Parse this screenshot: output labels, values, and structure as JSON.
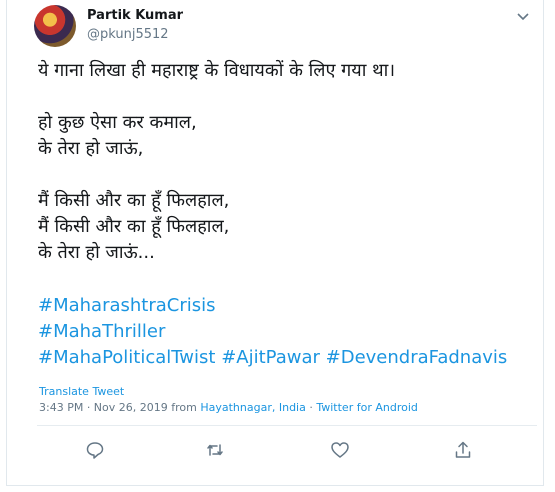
{
  "user": {
    "name": "Partik Kumar",
    "handle": "@pkunj5512"
  },
  "tweet": {
    "lines": [
      "ये गाना लिखा ही महाराष्ट्र के विधायकों के लिए गया था।",
      "",
      "हो कुछ ऐसा कर कमाल,",
      "के तेरा हो जाऊं,",
      "",
      "मैं किसी और का हूँ फिलहाल,",
      "मैं किसी और का हूँ फिलहाल,",
      "के तेरा हो जाऊं..."
    ],
    "hashtags": {
      "h1": "#MaharashtraCrisis",
      "h2": "#MahaThriller",
      "h3": "#MahaPoliticalTwist",
      "h4": "#AjitPawar",
      "h5": "#DevendraFadnavis"
    },
    "translate": "Translate Tweet",
    "time": "3:43 PM · Nov 26, 2019 from ",
    "location": "Hayathnagar, India",
    "sep": " · ",
    "source": "Twitter for Android"
  },
  "icons": {
    "more": "chevron-down-icon",
    "reply": "reply-icon",
    "retweet": "retweet-icon",
    "like": "heart-icon",
    "share": "share-icon"
  },
  "colors": {
    "link": "#1b95e0",
    "text": "#14171a",
    "muted": "#657786"
  }
}
